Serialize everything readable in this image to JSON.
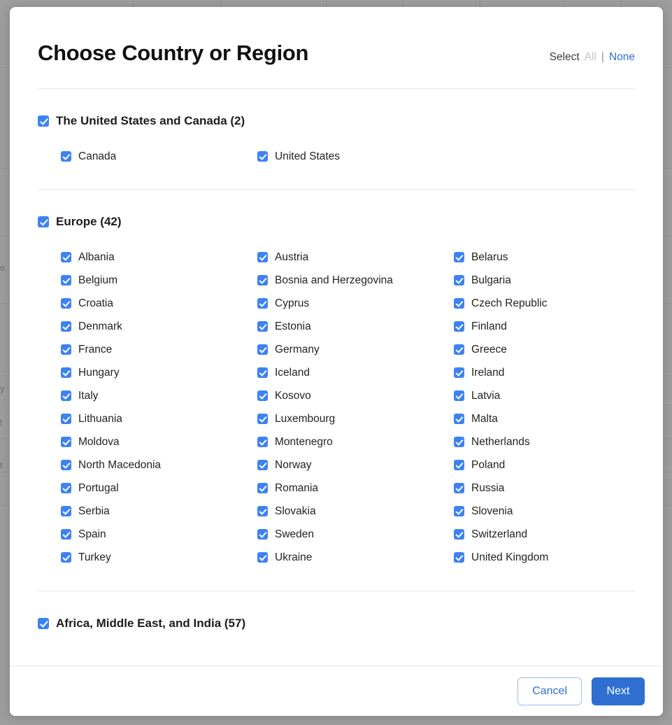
{
  "background": {
    "overlay_color": "#9d9d9d",
    "text_fragments": [
      "e",
      "y",
      "t",
      "t"
    ]
  },
  "modal": {
    "title": "Choose Country or Region",
    "select": {
      "label": "Select",
      "all_label": "All",
      "separator": "|",
      "none_label": "None"
    },
    "regions": [
      {
        "name": "us-canada",
        "title": "The United States and Canada (2)",
        "checked": true,
        "countries": [
          "Canada",
          "United States"
        ]
      },
      {
        "name": "europe",
        "title": "Europe (42)",
        "checked": true,
        "countries": [
          "Albania",
          "Austria",
          "Belarus",
          "Belgium",
          "Bosnia and Herzegovina",
          "Bulgaria",
          "Croatia",
          "Cyprus",
          "Czech Republic",
          "Denmark",
          "Estonia",
          "Finland",
          "France",
          "Germany",
          "Greece",
          "Hungary",
          "Iceland",
          "Ireland",
          "Italy",
          "Kosovo",
          "Latvia",
          "Lithuania",
          "Luxembourg",
          "Malta",
          "Moldova",
          "Montenegro",
          "Netherlands",
          "North Macedonia",
          "Norway",
          "Poland",
          "Portugal",
          "Romania",
          "Russia",
          "Serbia",
          "Slovakia",
          "Slovenia",
          "Spain",
          "Sweden",
          "Switzerland",
          "Turkey",
          "Ukraine",
          "United Kingdom"
        ]
      },
      {
        "name": "africa-middle-east-india",
        "title": "Africa, Middle East, and India (57)",
        "checked": true,
        "countries": []
      }
    ],
    "footer": {
      "cancel_label": "Cancel",
      "next_label": "Next"
    }
  },
  "colors": {
    "accent": "#2f6fd0",
    "checkbox": "#3d82f2",
    "link": "#2f6fd0",
    "disabled": "#c3c3c3",
    "divider": "#e6e6e6"
  }
}
